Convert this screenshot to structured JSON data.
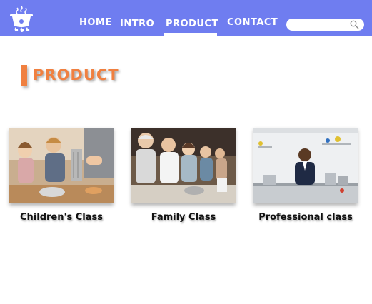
{
  "nav": {
    "items": [
      {
        "label": "HOME"
      },
      {
        "label": "INTRO"
      },
      {
        "label": "PRODUCT",
        "active": true
      },
      {
        "label": "CONTACT"
      }
    ],
    "search": {
      "placeholder": "",
      "value": ""
    },
    "logo_icon": "cooking-pot-logo-icon",
    "search_icon": "search-icon"
  },
  "section": {
    "title": "PRODUCT"
  },
  "products": [
    {
      "caption": "Children's Class",
      "image": "children-cooking-photo"
    },
    {
      "caption": "Family Class",
      "image": "family-cooking-photo"
    },
    {
      "caption": "Professional class",
      "image": "chef-kitchen-photo"
    }
  ],
  "colors": {
    "nav_bg": "#6f7df0",
    "accent": "#f08040",
    "text": "#111111"
  }
}
